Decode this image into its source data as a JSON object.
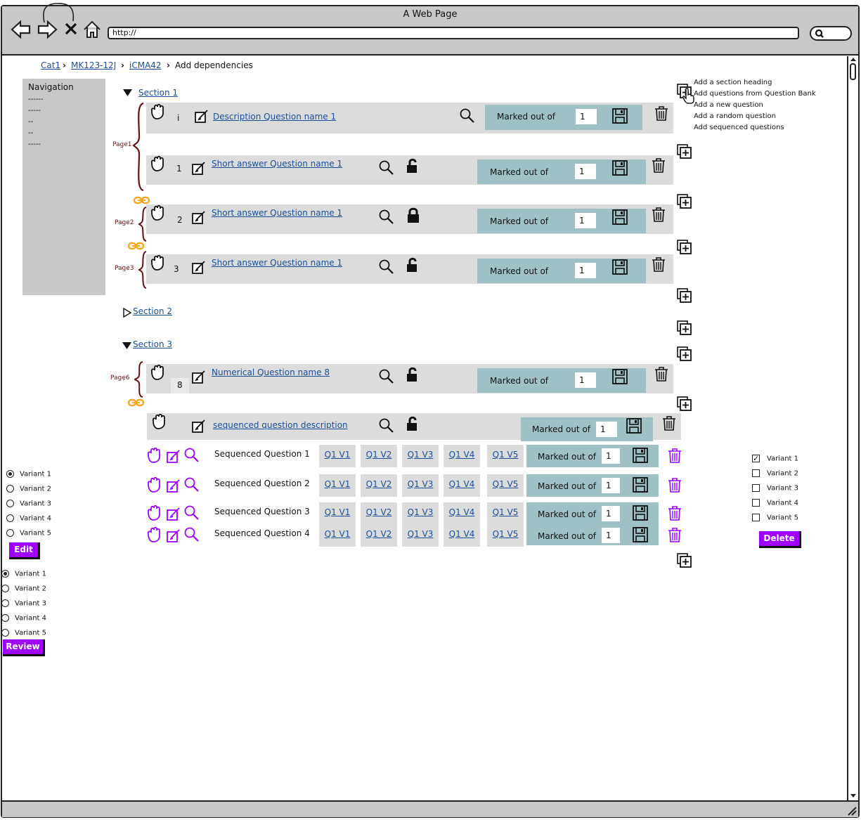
{
  "window": {
    "title": "A Web Page",
    "url": "http://"
  },
  "breadcrumb": {
    "items": [
      "Cat1",
      "MK123-12J",
      "iCMA42"
    ],
    "current": "Add dependencies"
  },
  "nav": {
    "title": "Navigation",
    "items": [
      "------",
      "-----",
      "--",
      "--",
      "-----"
    ]
  },
  "sections": {
    "s1": "Section 1",
    "s2": "Section 2",
    "s3": "Section 3"
  },
  "pages": {
    "p1": "Page1",
    "p2": "Page2",
    "p3": "Page3",
    "p6": "Page6"
  },
  "marked": {
    "label": "Marked out of",
    "value": "1"
  },
  "questions": [
    {
      "num": "i",
      "name": "Description Question name 1"
    },
    {
      "num": "1",
      "name": "Short answer Question name 1"
    },
    {
      "num": "2",
      "name": "Short answer Question name 1"
    },
    {
      "num": "3",
      "name": "Short answer Question name 1"
    },
    {
      "num": "8",
      "name": "Numerical Question name 8"
    }
  ],
  "sequenced": {
    "description": "sequenced question description",
    "rows": [
      {
        "name": "Sequenced Question 1",
        "variants": [
          "Q1 V1",
          "Q1 V2",
          "Q1 V3",
          "Q1 V4",
          "Q1 V5"
        ]
      },
      {
        "name": "Sequenced Question 2",
        "variants": [
          "Q1 V1",
          "Q1 V2",
          "Q1 V3",
          "Q1 V4",
          "Q1 V5"
        ]
      },
      {
        "name": "Sequenced Question 3",
        "variants": [
          "Q1 V1",
          "Q1 V2",
          "Q1 V3",
          "Q1 V4",
          "Q1 V5"
        ]
      },
      {
        "name": "Sequenced Question 4",
        "variants": [
          "Q1 V1",
          "Q1 V2",
          "Q1 V3",
          "Q1 V4",
          "Q1 V5"
        ]
      }
    ]
  },
  "add_menu": [
    "Add a section heading",
    "Add questions from Question Bank",
    "Add a new question",
    "Add a random question",
    "Add sequenced questions"
  ],
  "variant_edit": {
    "options": [
      "Variant 1",
      "Variant 2",
      "Variant 3",
      "Variant 4",
      "Variant 5"
    ],
    "selected": 0,
    "button": "Edit"
  },
  "variant_review": {
    "options": [
      "Variant 1",
      "Variant 2",
      "Variant 3",
      "Variant 4",
      "Variant 5"
    ],
    "selected": 0,
    "button": "Review"
  },
  "variant_delete": {
    "options": [
      "Variant 1",
      "Variant 2",
      "Variant 3",
      "Variant 4",
      "Variant 5"
    ],
    "checked": 0,
    "button": "Delete"
  },
  "colors": {
    "accent": "#a000ff",
    "marked_bg": "#9fc0c4",
    "row_bg": "#dcdcdc",
    "page_brace": "#6b0f0f",
    "link_chain": "#f5a623"
  }
}
